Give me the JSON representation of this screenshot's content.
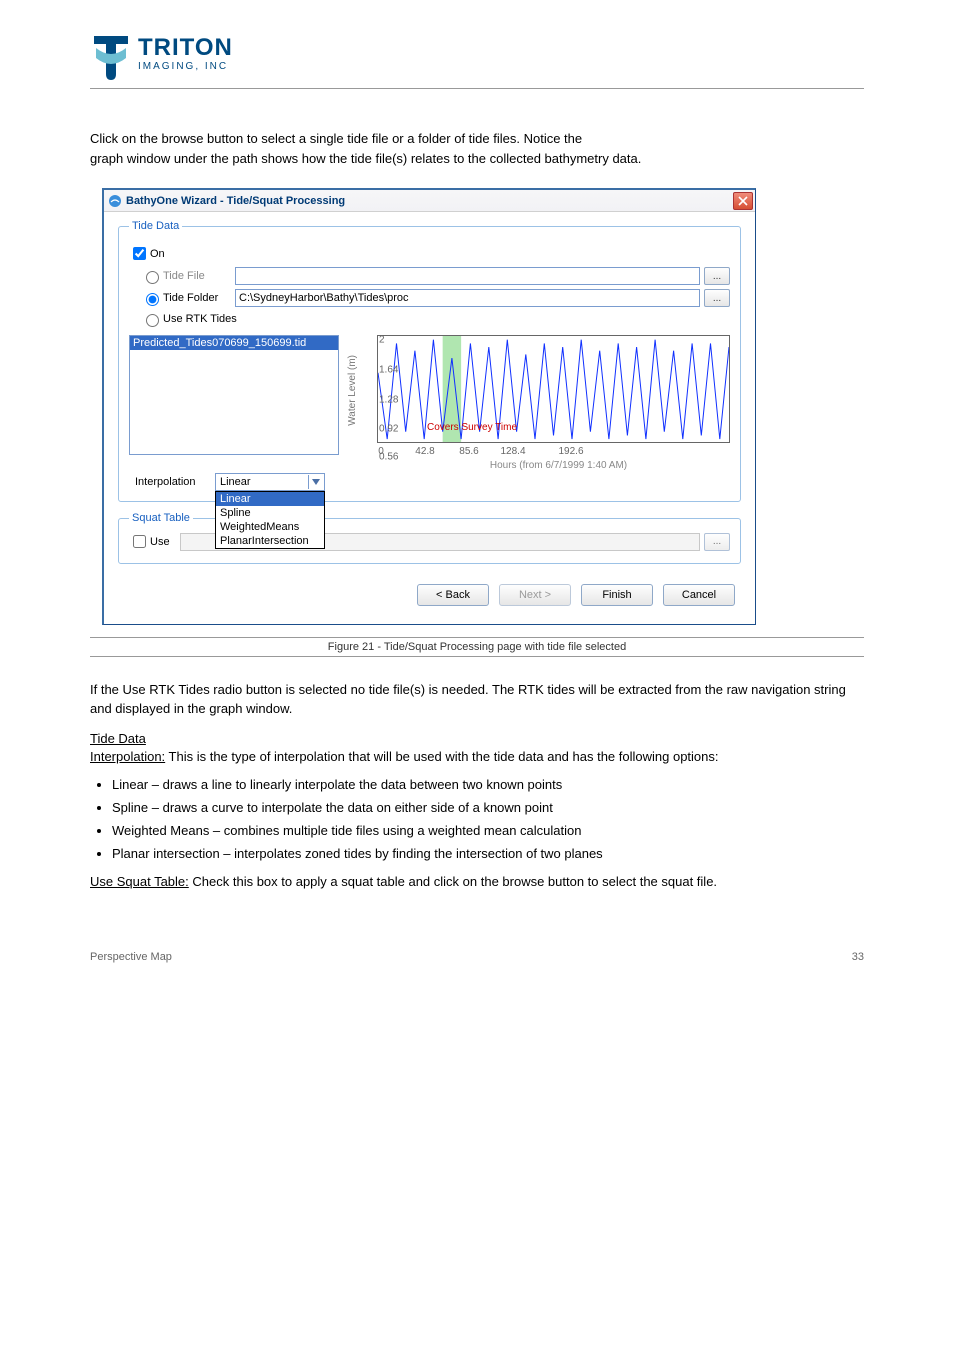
{
  "header": {
    "brand_top": "TRITON",
    "brand_bot": "IMAGING, INC"
  },
  "intro": {
    "line1": "Click on the browse button",
    "line2": "to select a single tide file or a folder of tide files. Notice the",
    "line3": "graph window under the path shows how the tide file(s) relates to the collected bathymetry data."
  },
  "dialog": {
    "title": "BathyOne Wizard - Tide/Squat Processing",
    "tide_group": "Tide Data",
    "on_label": "On",
    "tide_file_label": "Tide File",
    "tide_folder_label": "Tide Folder",
    "tide_folder_path": "C:\\SydneyHarbor\\Bathy\\Tides\\proc",
    "use_rtk_label": "Use RTK Tides",
    "file_item": "Predicted_Tides070699_150699.tid",
    "interp_label": "Interpolation",
    "interp_value": "Linear",
    "interp_options": [
      "Linear",
      "Spline",
      "WeightedMeans",
      "PlanarIntersection"
    ],
    "squat_group": "Squat Table",
    "use_label": "Use",
    "browse": "...",
    "btn_back": "< Back",
    "btn_next": "Next >",
    "btn_finish": "Finish",
    "btn_cancel": "Cancel"
  },
  "chart_data": {
    "type": "line",
    "title": "",
    "xlabel": "Hours (from 6/7/1999 1:40 AM)",
    "ylabel": "Water Level (m)",
    "ylim": [
      0.56,
      2.0
    ],
    "yticks": [
      2.0,
      1.64,
      1.28,
      0.92,
      0.56
    ],
    "xticks": [
      0.0,
      42.8,
      85.6,
      128.4,
      192.6
    ],
    "annotation": "Covers Survey Time",
    "series": [
      {
        "name": "tide",
        "color": "#1030ff",
        "x": [
          0,
          5,
          10,
          15,
          20,
          25,
          30,
          35,
          40,
          45,
          50,
          55,
          60,
          65,
          70,
          75,
          80,
          85,
          90,
          95,
          100,
          105,
          110,
          115,
          120,
          125,
          130,
          135,
          140,
          145,
          150,
          155,
          160,
          165,
          170,
          175,
          180,
          185,
          190
        ],
        "values": [
          1.5,
          0.6,
          1.9,
          0.7,
          1.8,
          0.6,
          1.95,
          0.7,
          1.7,
          0.6,
          1.9,
          0.7,
          1.85,
          0.6,
          1.95,
          0.7,
          1.75,
          0.6,
          1.9,
          0.65,
          1.85,
          0.6,
          1.95,
          0.7,
          1.8,
          0.6,
          1.9,
          0.65,
          1.85,
          0.6,
          1.95,
          0.7,
          1.8,
          0.6,
          1.9,
          0.65,
          1.9,
          0.6,
          1.85
        ]
      }
    ]
  },
  "figure_caption": "Figure 21 - Tide/Squat Processing page with tide file selected",
  "body": {
    "p1": "If the Use RTK Tides radio button is selected no tide file(s) is needed. The RTK tides will be extracted from the raw navigation string and displayed in the graph window.",
    "t1": "Tide Data",
    "t2_label": "Interpolation:",
    "t2_rest": " This is the type of interpolation that will be used with the tide data and has the following options:",
    "b1": "Linear – draws a line to linearly interpolate the data between two known points ",
    "b2": "Spline – draws a curve to interpolate the data on either side of a known point",
    "b3": "Weighted Means – combines multiple tide files using a weighted mean calculation",
    "b4": "Planar intersection – interpolates zoned tides by finding the intersection of two planes",
    "t3_label": "Use Squat Table:",
    "t3_rest": " Check this box to apply a squat table and click on the browse button to select the squat file."
  },
  "footer": {
    "left": "Perspective Map",
    "right": "33"
  }
}
